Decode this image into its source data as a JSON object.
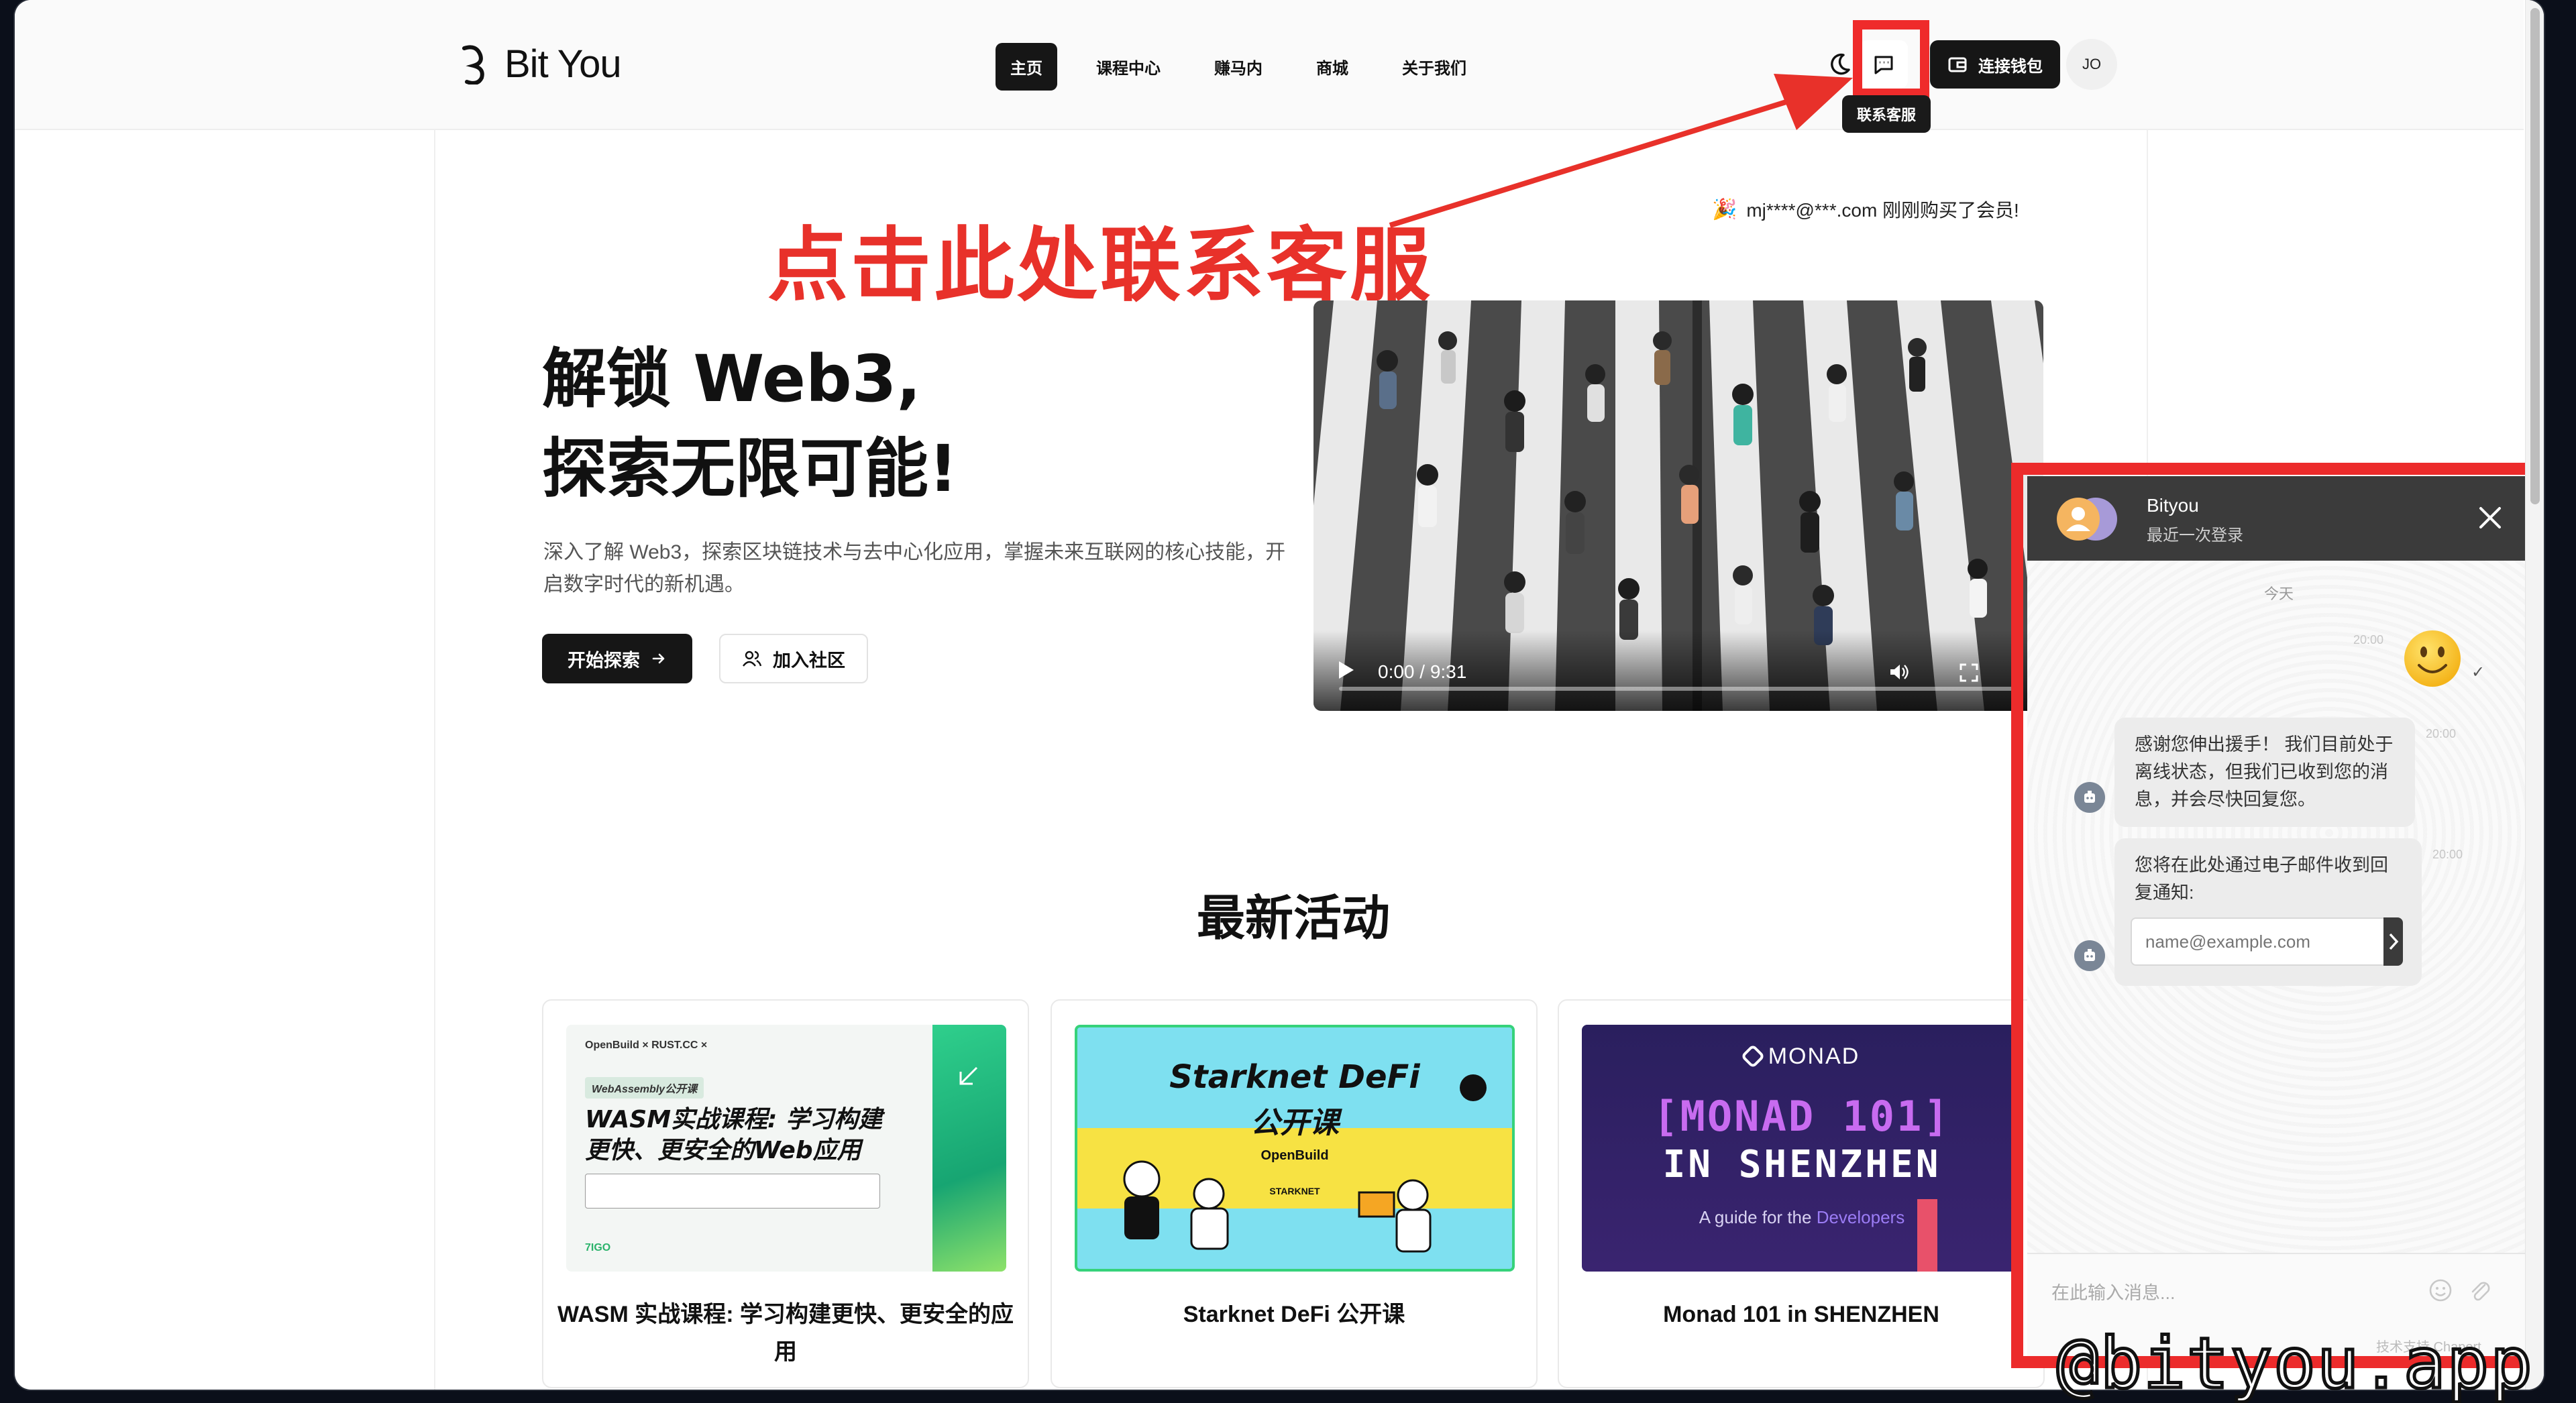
{
  "site": {
    "name": "Bit You"
  },
  "nav": {
    "items": [
      {
        "label": "主页",
        "active": true
      },
      {
        "label": "课程中心",
        "active": false
      },
      {
        "label": "赚马内",
        "active": false
      },
      {
        "label": "商城",
        "active": false
      },
      {
        "label": "关于我们",
        "active": false
      }
    ]
  },
  "header": {
    "chat_tooltip": "联系客服",
    "wallet_label": "连接钱包",
    "user_initials": "JO"
  },
  "annotation": {
    "text": "点击此处联系客服",
    "color": "#e8312a"
  },
  "purchase_note": "mj****@***.com 刚刚购买了会员!",
  "hero": {
    "title_line1": "解锁 Web3,",
    "title_line2": "探索无限可能!",
    "description": "深入了解 Web3，探索区块链技术与去中心化应用，掌握未来互联网的核心技能，开启数字时代的新机遇。",
    "primary_button": "开始探索",
    "secondary_button": "加入社区"
  },
  "video": {
    "time": "0:00 / 9:31"
  },
  "activities": {
    "title": "最新活动",
    "cards": [
      {
        "title": "WASM 实战课程: 学习构建更快、更安全的应用",
        "image": {
          "tag": "WebAssembly公开课",
          "headline_line1": "WASM实战课程: 学习构建",
          "headline_line2": "更快、更安全的Web应用",
          "brands": "OpenBuild  ×  RUST.CC  ×",
          "footer_tag": "7IGO"
        }
      },
      {
        "title": "Starknet DeFi 公开课",
        "image": {
          "headline_line1": "Starknet DeFi",
          "headline_line2": "公开课",
          "brand1": "OpenBuild",
          "brand2": "STARKNET"
        }
      },
      {
        "title": "Monad 101 in SHENZHEN",
        "image": {
          "brand": "MONAD",
          "headline_line1": "[MONAD 101]",
          "headline_line2": "IN SHENZHEN",
          "subline_prefix": "A guide for the ",
          "subline_highlight": "Developers"
        }
      }
    ]
  },
  "chat": {
    "agent_name": "Bityou",
    "agent_status": "最近一次登录",
    "day_label": "今天",
    "emoji_time": "20:00",
    "messages": [
      {
        "text": "感谢您伸出援手！ 我们目前处于离线状态，但我们已收到您的消息，并会尽快回复您。",
        "time": "20:00"
      },
      {
        "text": "您将在此处通过电子邮件收到回复通知:",
        "time": "20:00"
      }
    ],
    "email_placeholder": "name@example.com",
    "input_placeholder": "在此输入消息...",
    "powered_by": "技术支持 Chaport"
  },
  "watermark": "@bityou.app"
}
